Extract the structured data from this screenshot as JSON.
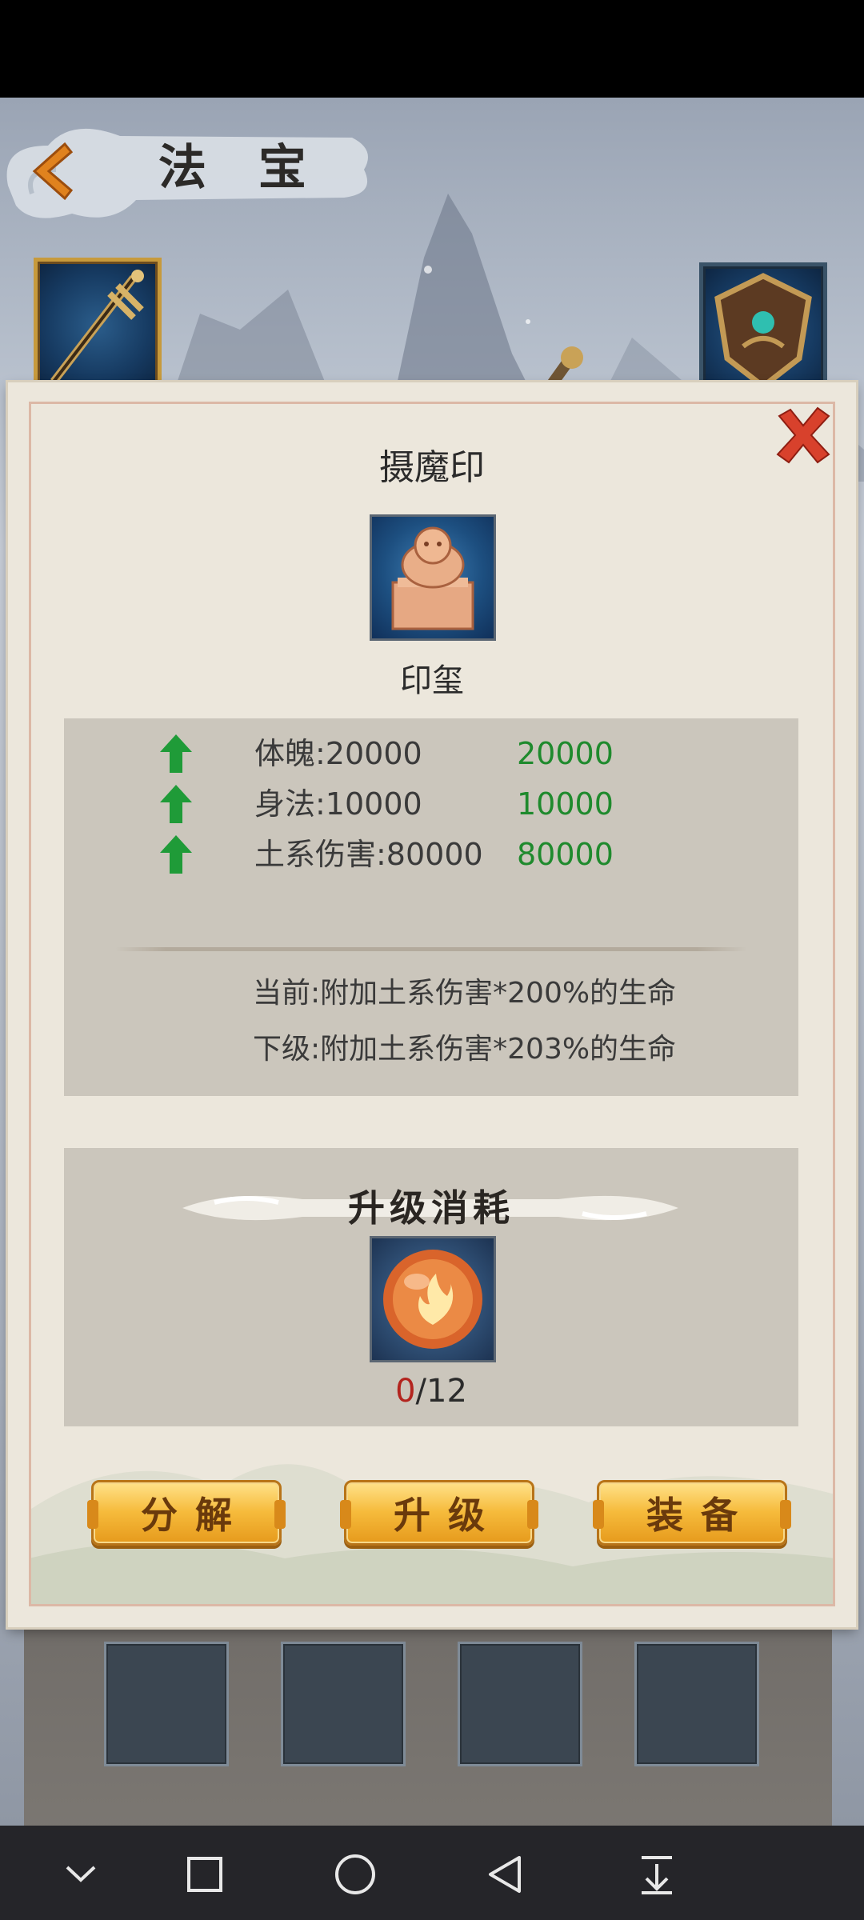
{
  "header": {
    "title": "法 宝",
    "back_icon": "chevron-left-icon"
  },
  "equipment_slots": {
    "left": {
      "icon": "sword-icon"
    },
    "right": {
      "icon": "shield-icon"
    }
  },
  "dialog": {
    "close_icon": "close-x-icon",
    "item_name": "摄魔印",
    "item_icon": "jade-seal-icon",
    "item_type": "印玺",
    "stats": [
      {
        "label": "体魄:20000",
        "next_value": "20000",
        "arrow": "up-arrow-icon"
      },
      {
        "label": "身法:10000",
        "next_value": "10000",
        "arrow": "up-arrow-icon"
      },
      {
        "label": "土系伤害:80000",
        "next_value": "80000",
        "arrow": "up-arrow-icon"
      }
    ],
    "effects": {
      "current": "当前:附加土系伤害*200%的生命",
      "next": "下级:附加土系伤害*203%的生命"
    },
    "upgrade_cost": {
      "title": "升级消耗",
      "material_icon": "fire-orb-icon",
      "have": "0",
      "need": "/12"
    },
    "buttons": {
      "decompose": "分解",
      "upgrade": "升级",
      "equip": "装备"
    },
    "colors": {
      "stat_increase": "#1f8a2d",
      "insufficient": "#b3241e",
      "button_gold": "#f6bb3c"
    }
  },
  "navbar": {
    "items": [
      "chevron-down-icon",
      "square-icon",
      "circle-icon",
      "triangle-back-icon",
      "download-icon"
    ]
  }
}
